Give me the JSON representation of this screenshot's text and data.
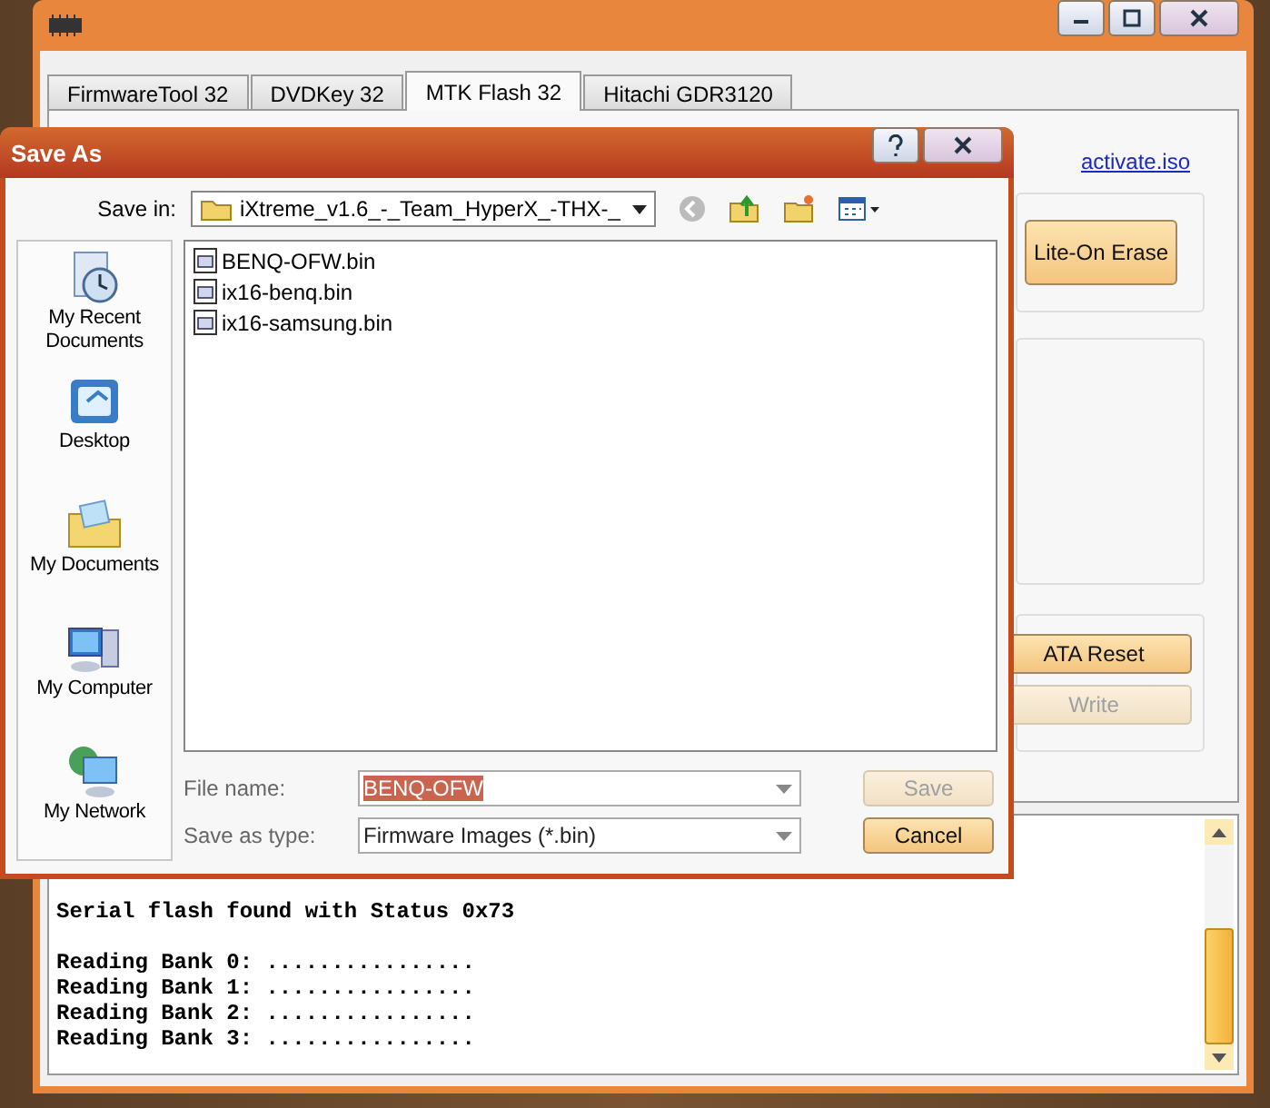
{
  "main_window": {
    "tabs": [
      {
        "label": "FirmwareTool 32",
        "selected": false
      },
      {
        "label": "DVDKey 32",
        "selected": false
      },
      {
        "label": "MTK Flash 32",
        "selected": true
      },
      {
        "label": "Hitachi GDR3120",
        "selected": false
      }
    ],
    "link": "activate.iso",
    "groups": [
      {
        "buttons": [
          {
            "label": "Lite-On Erase",
            "disabled": false
          }
        ]
      },
      {
        "buttons": [
          {
            "label": "ATA Reset",
            "disabled": false
          },
          {
            "label": "Write",
            "disabled": true
          }
        ]
      }
    ],
    "log": {
      "blocks": [
        [
          "Serial flash found with Status 0x73"
        ],
        [
          "Reading Bank 0: ................",
          "Reading Bank 1: ................",
          "Reading Bank 2: ................",
          "Reading Bank 3: ................"
        ]
      ]
    }
  },
  "dialog": {
    "title": "Save As",
    "save_in": {
      "label": "Save in:",
      "value": "iXtreme_v1.6_-_Team_HyperX_-THX-_"
    },
    "places": [
      {
        "kind": "recent",
        "label": "My Recent Documents"
      },
      {
        "kind": "desktop",
        "label": "Desktop"
      },
      {
        "kind": "documents",
        "label": "My Documents"
      },
      {
        "kind": "computer",
        "label": "My Computer"
      },
      {
        "kind": "network",
        "label": "My Network"
      }
    ],
    "files": [
      "BENQ-OFW.bin",
      "ix16-benq.bin",
      "ix16-samsung.bin"
    ],
    "file_name": {
      "label": "File name:",
      "value": "BENQ-OFW",
      "highlighted": true
    },
    "save_as_type": {
      "label": "Save as type:",
      "value": "Firmware Images (*.bin)"
    },
    "buttons": [
      {
        "label": "Save",
        "disabled": true
      },
      {
        "label": "Cancel",
        "disabled": false
      }
    ]
  }
}
